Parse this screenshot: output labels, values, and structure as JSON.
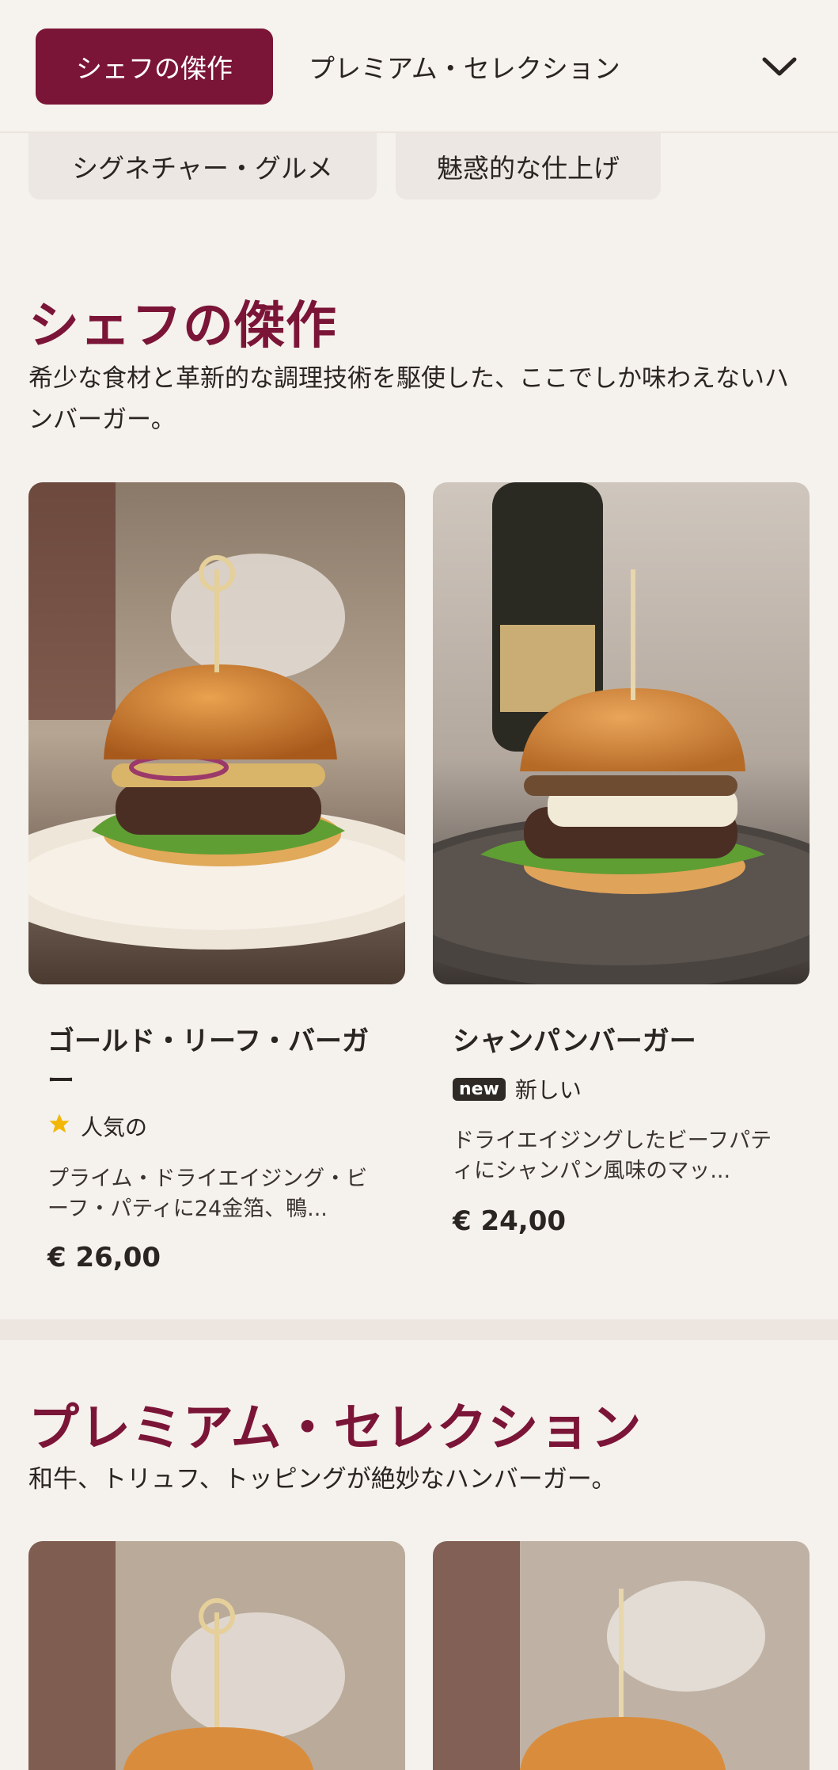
{
  "nav": {
    "active_tab": "シェフの傑作",
    "tab2": "プレミアム・セレクション",
    "row2_a": "シグネチャー・グルメ",
    "row2_b": "魅惑的な仕上げ",
    "expand_icon": "chevron-down-icon"
  },
  "sections": [
    {
      "title": "シェフの傑作",
      "description": "希少な食材と革新的な調理技術を駆使した、ここでしか味わえないハンバーガー。",
      "items": [
        {
          "name": "ゴールド・リーフ・バーガー",
          "badge_icon": "star-icon",
          "badge_text": "人気の",
          "description": "プライム・ドライエイジング・ビーフ・パティに24金箔、鴨...",
          "price": "€ 26,00"
        },
        {
          "name": "シャンパンバーガー",
          "badge_label": "new",
          "badge_text": "新しい",
          "description": "ドライエイジングしたビーフパティにシャンパン風味のマッ...",
          "price": "€ 24,00"
        }
      ]
    },
    {
      "title": "プレミアム・セレクション",
      "description": "和牛、トリュフ、トッピングが絶妙なハンバーガー。"
    }
  ],
  "colors": {
    "accent": "#7b1538",
    "background": "#f5f1ec"
  }
}
